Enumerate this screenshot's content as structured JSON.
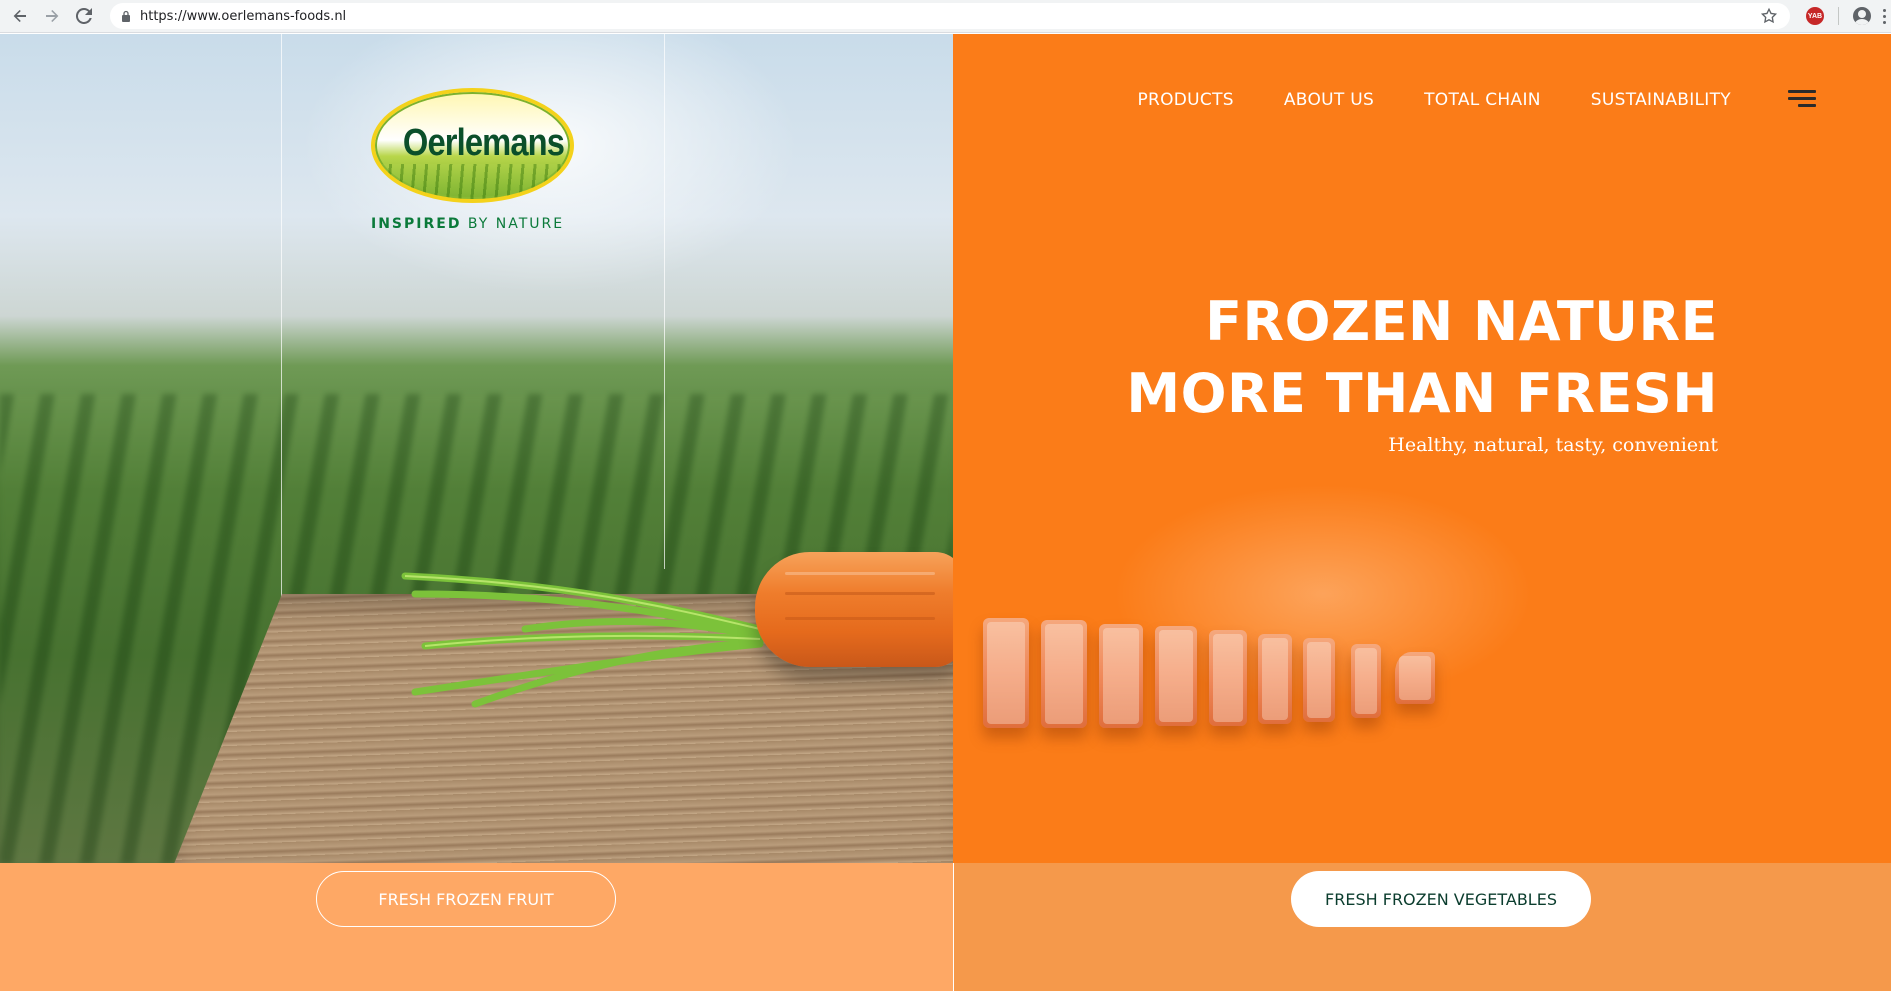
{
  "browser": {
    "url": "https://www.oerlemans-foods.nl",
    "extension_badge": "YAB"
  },
  "brand": {
    "name": "Oerlemans",
    "tagline_bold": "INSPIRED",
    "tagline_rest": "BY NATURE"
  },
  "nav": {
    "items": [
      {
        "label": "PRODUCTS"
      },
      {
        "label": "ABOUT US"
      },
      {
        "label": "TOTAL CHAIN"
      },
      {
        "label": "SUSTAINABILITY"
      }
    ]
  },
  "hero": {
    "headline_line1": "FROZEN NATURE",
    "headline_line2": "MORE THAN FRESH",
    "subline": "Healthy, natural, tasty, convenient"
  },
  "cta": {
    "fruit_label": "FRESH FROZEN FRUIT",
    "vegetables_label": "FRESH FROZEN VEGETABLES"
  },
  "colors": {
    "accent_orange": "#fb7c18",
    "bottom_left": "#fea865",
    "bottom_right": "#f5994b",
    "brand_green": "#0b4f2a"
  }
}
